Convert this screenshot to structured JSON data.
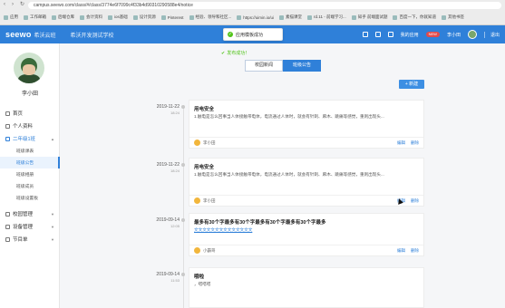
{
  "browser": {
    "url": "campus.seewo.com/class/#/class/3774e6f7099c4f33b4d90310290588e4/notice",
    "bookmarks": [
      "应用",
      "工作邮箱",
      "后端仓库",
      "会计资料",
      "ios基础",
      "设计资源",
      "Pinterest",
      "经验、领导和社区...",
      "https://uimin.io/ui",
      "素描课堂",
      "rd.11 - 前端学习...",
      "知乎 前端面试题",
      "百度一下，你就知道",
      "其他书签"
    ]
  },
  "header": {
    "logo": "seewo",
    "logo_sub": "希沃云班",
    "school": "希沃开发测试学校",
    "my_apps": "我的应用",
    "badge": "NEW",
    "user": "李小田",
    "exit": "退出"
  },
  "toast_top": {
    "text": "应用模板成功"
  },
  "toast_inline": {
    "text": "发布成功！"
  },
  "sidebar": {
    "user_name": "李小田",
    "menu": [
      {
        "label": "首页"
      },
      {
        "label": "个人资料"
      },
      {
        "label": "二年级1班"
      }
    ],
    "submenu": [
      "班级课表",
      "班级公告",
      "班级相册",
      "班级成员",
      "班级设置板"
    ],
    "menu_bottom": [
      {
        "label": "校园管理"
      },
      {
        "label": "设备管理"
      },
      {
        "label": "节目单"
      }
    ]
  },
  "tabs": [
    "校园新闻",
    "班级公告"
  ],
  "new_button": "+ 新建",
  "notices": [
    {
      "date": "2019-11-22",
      "time": "18:24",
      "title": "用电安全",
      "body": "1.触电是怎么回事当人体接触带电体，电流通过人体时，就会有针刺、麻木、跳痛等感觉，重则出现头...",
      "author": "李小田",
      "edit": "编辑",
      "delete": "删除"
    },
    {
      "date": "2019-11-22",
      "time": "18:24",
      "title": "用电安全",
      "body": "1.触电是怎么回事当人体接触带电体，电流通过人体时，就会有针刺、麻木、跳痛等感觉，重则出现头...",
      "author": "李小田",
      "edit": "编辑",
      "delete": "删除"
    },
    {
      "date": "2019-09-14",
      "time": "12:05",
      "title": "最多有30个字最多有30个字最多有30个字最多有30个字最多",
      "body": "文文文文文文文文文文文文文文",
      "author": "小霸哥",
      "edit": "编辑",
      "delete": "删除"
    },
    {
      "date": "2019-09-14",
      "time": "11:53",
      "title": "哦啦",
      "body": "，嗒嗒嗒",
      "author": "",
      "edit": "",
      "delete": ""
    }
  ],
  "colors": {
    "primary": "#2f80d9",
    "success": "#52c41a",
    "badge": "#e34a4a"
  }
}
